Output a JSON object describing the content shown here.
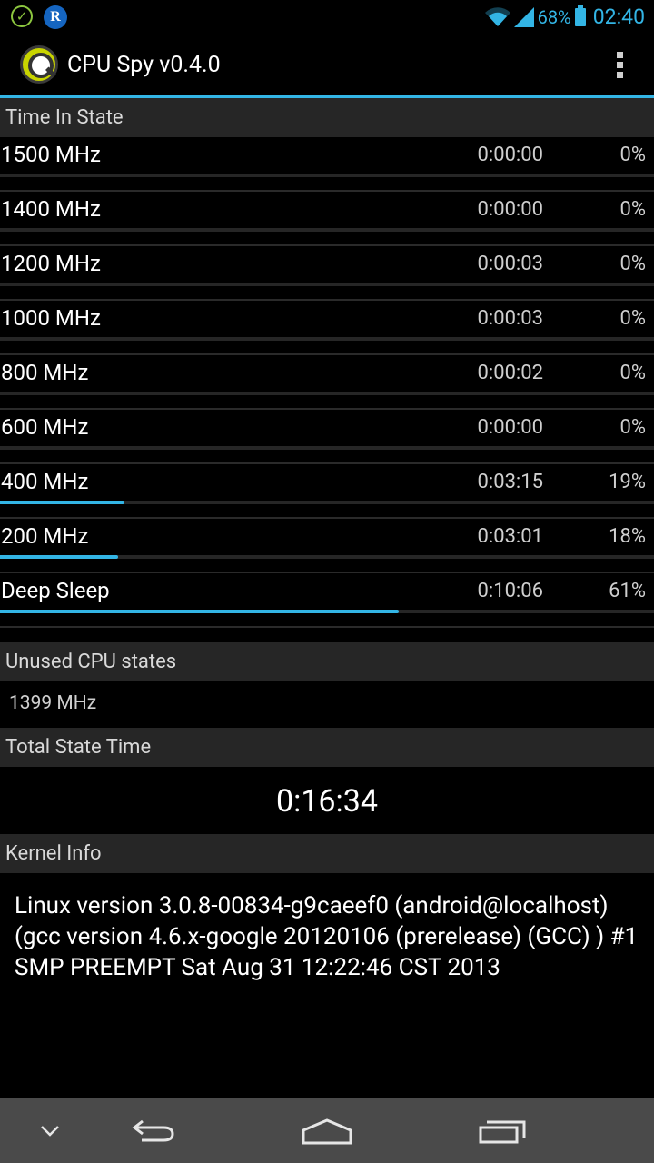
{
  "status_bar": {
    "battery_percent": "68%",
    "time": "02:40",
    "accent_color": "#33b5e5",
    "icons": [
      "check-circle-icon",
      "r-app-icon",
      "wifi-icon",
      "signal-icon",
      "battery-icon"
    ]
  },
  "action_bar": {
    "title": "CPU Spy v0.4.0",
    "menu_icon": "overflow-menu-icon"
  },
  "time_in_state": {
    "header": "Time In State",
    "rows": [
      {
        "freq": "1500 MHz",
        "time": "0:00:00",
        "percent": "0%",
        "fraction": 0.0
      },
      {
        "freq": "1400 MHz",
        "time": "0:00:00",
        "percent": "0%",
        "fraction": 0.0
      },
      {
        "freq": "1200 MHz",
        "time": "0:00:03",
        "percent": "0%",
        "fraction": 0.0
      },
      {
        "freq": "1000 MHz",
        "time": "0:00:03",
        "percent": "0%",
        "fraction": 0.0
      },
      {
        "freq": "800 MHz",
        "time": "0:00:02",
        "percent": "0%",
        "fraction": 0.0
      },
      {
        "freq": "600 MHz",
        "time": "0:00:00",
        "percent": "0%",
        "fraction": 0.0
      },
      {
        "freq": "400 MHz",
        "time": "0:03:15",
        "percent": "19%",
        "fraction": 0.19
      },
      {
        "freq": "200 MHz",
        "time": "0:03:01",
        "percent": "18%",
        "fraction": 0.18
      },
      {
        "freq": "Deep Sleep",
        "time": "0:10:06",
        "percent": "61%",
        "fraction": 0.61
      }
    ]
  },
  "unused_cpu_states": {
    "header": "Unused CPU states",
    "value": "1399 MHz"
  },
  "total_state_time": {
    "header": "Total State Time",
    "value": "0:16:34"
  },
  "kernel_info": {
    "header": "Kernel Info",
    "text": "Linux version 3.0.8-00834-g9caeef0 (android@localhost) (gcc version 4.6.x-google 20120106 (prerelease) (GCC) ) #1 SMP PREEMPT Sat Aug 31 12:22:46 CST 2013"
  },
  "nav_bar": {
    "buttons": [
      "chevron-down-icon",
      "back-icon",
      "home-icon",
      "recent-apps-icon"
    ]
  }
}
